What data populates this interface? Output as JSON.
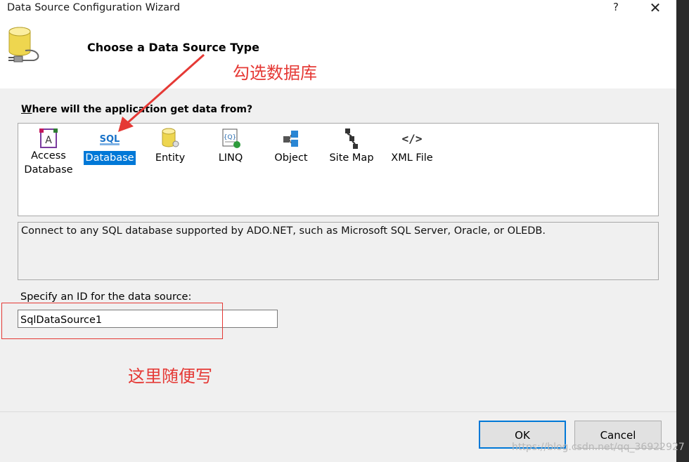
{
  "window": {
    "title": "Data Source Configuration Wizard",
    "help": "?",
    "close": "✕"
  },
  "header": {
    "title": "Choose a Data Source Type"
  },
  "question": "Where will the application get data from?",
  "types": [
    {
      "label": "Access Database",
      "icon": "access-db-icon",
      "selected": false
    },
    {
      "label": "Database",
      "icon": "sql-icon",
      "selected": true
    },
    {
      "label": "Entity",
      "icon": "entity-icon",
      "selected": false
    },
    {
      "label": "LINQ",
      "icon": "linq-icon",
      "selected": false
    },
    {
      "label": "Object",
      "icon": "object-icon",
      "selected": false
    },
    {
      "label": "Site Map",
      "icon": "sitemap-icon",
      "selected": false
    },
    {
      "label": "XML File",
      "icon": "xml-icon",
      "selected": false
    }
  ],
  "description": "Connect to any SQL database supported by ADO.NET, such as Microsoft SQL Server, Oracle, or OLEDB.",
  "id_field": {
    "label": "Specify an ID for the data source:",
    "value": "SqlDataSource1"
  },
  "buttons": {
    "ok": "OK",
    "cancel": "Cancel"
  },
  "annotations": {
    "note1": "勾选数据库",
    "note2": "这里随便写",
    "color": "#e53935"
  },
  "watermark": "https://blog.csdn.net/qq_36922927",
  "colors": {
    "selection": "#0078d7",
    "panel": "#f0f0f0"
  }
}
